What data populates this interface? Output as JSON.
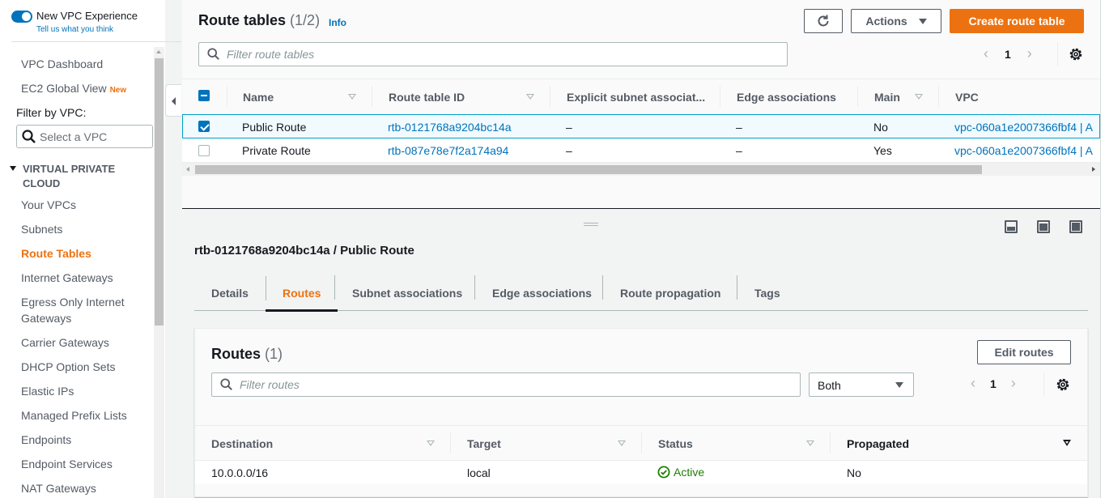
{
  "sidebar": {
    "experience_toggle": {
      "label": "New VPC Experience",
      "link": "Tell us what you think",
      "on": true
    },
    "items_top": [
      {
        "label": "VPC Dashboard"
      },
      {
        "label": "EC2 Global View",
        "badge": "New"
      }
    ],
    "filter_label": "Filter by VPC:",
    "vpc_select_placeholder": "Select a VPC",
    "section_title_line1": "VIRTUAL PRIVATE",
    "section_title_line2": "CLOUD",
    "section_items": [
      {
        "label": "Your VPCs",
        "active": false
      },
      {
        "label": "Subnets",
        "active": false
      },
      {
        "label": "Route Tables",
        "active": true
      },
      {
        "label": "Internet Gateways",
        "active": false
      },
      {
        "label": "Egress Only Internet",
        "label2": "Gateways",
        "active": false
      },
      {
        "label": "Carrier Gateways",
        "active": false
      },
      {
        "label": "DHCP Option Sets",
        "active": false
      },
      {
        "label": "Elastic IPs",
        "active": false
      },
      {
        "label": "Managed Prefix Lists",
        "active": false
      },
      {
        "label": "Endpoints",
        "active": false
      },
      {
        "label": "Endpoint Services",
        "active": false
      },
      {
        "label": "NAT Gateways",
        "active": false
      }
    ]
  },
  "route_tables": {
    "title": "Route tables",
    "count": "(1/2)",
    "info": "Info",
    "refresh_icon": "refresh-icon",
    "actions_label": "Actions",
    "create_label": "Create route table",
    "filter_placeholder": "Filter route tables",
    "page": "1",
    "columns": [
      "Name",
      "Route table ID",
      "Explicit subnet associat...",
      "Edge associations",
      "Main",
      "VPC"
    ],
    "rows": [
      {
        "selected": true,
        "name": "Public Route",
        "id": "rtb-0121768a9204bc14a",
        "explicit": "–",
        "edge": "–",
        "main": "No",
        "vpc": "vpc-060a1e2007366fbf4 | A"
      },
      {
        "selected": false,
        "name": "Private Route",
        "id": "rtb-087e78e7f2a174a94",
        "explicit": "–",
        "edge": "–",
        "main": "Yes",
        "vpc": "vpc-060a1e2007366fbf4 | A"
      }
    ]
  },
  "details": {
    "title": "rtb-0121768a9204bc14a / Public Route",
    "tabs": [
      {
        "label": "Details",
        "active": false
      },
      {
        "label": "Routes",
        "active": true
      },
      {
        "label": "Subnet associations",
        "active": false
      },
      {
        "label": "Edge associations",
        "active": false
      },
      {
        "label": "Route propagation",
        "active": false
      },
      {
        "label": "Tags",
        "active": false
      }
    ],
    "routes": {
      "title": "Routes",
      "count": "(1)",
      "edit_label": "Edit routes",
      "filter_placeholder": "Filter routes",
      "select_value": "Both",
      "page": "1",
      "columns": [
        "Destination",
        "Target",
        "Status",
        "Propagated"
      ],
      "rows": [
        {
          "destination": "10.0.0.0/16",
          "target": "local",
          "status": "Active",
          "propagated": "No"
        }
      ]
    }
  },
  "colors": {
    "accent_orange": "#ec7211",
    "link_blue": "#0073bb",
    "status_green": "#1d8102"
  }
}
